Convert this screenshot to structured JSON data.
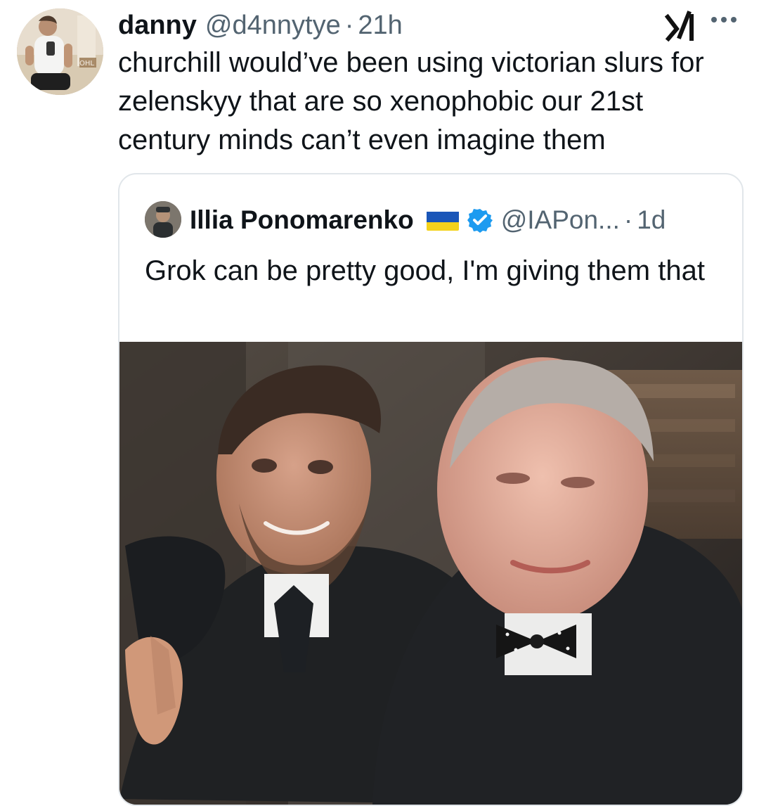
{
  "tweet": {
    "author_name": "danny",
    "author_handle": "@d4nnytye",
    "separator": "·",
    "time": "21h",
    "text": "churchill would’ve been using victorian slurs for\nzelenskyy that are so xenophobic our 21st\ncentury minds can’t even imagine them",
    "icons": {
      "avatar": "avatar",
      "grok": "grok-icon",
      "more": "more-icon"
    }
  },
  "quoted_tweet": {
    "author_name": "Illia Ponomarenko",
    "author_handle": "@IAPon...",
    "separator": "·",
    "time": "1d",
    "text": "Grok can be pretty good, I'm giving them that",
    "icons": {
      "flag": "ukraine-flag-icon",
      "verified": "verified-badge-icon"
    },
    "colors": {
      "flag_blue": "#1a56b8",
      "flag_yellow": "#f4d21b",
      "verified_blue": "#1d9bf0"
    }
  }
}
